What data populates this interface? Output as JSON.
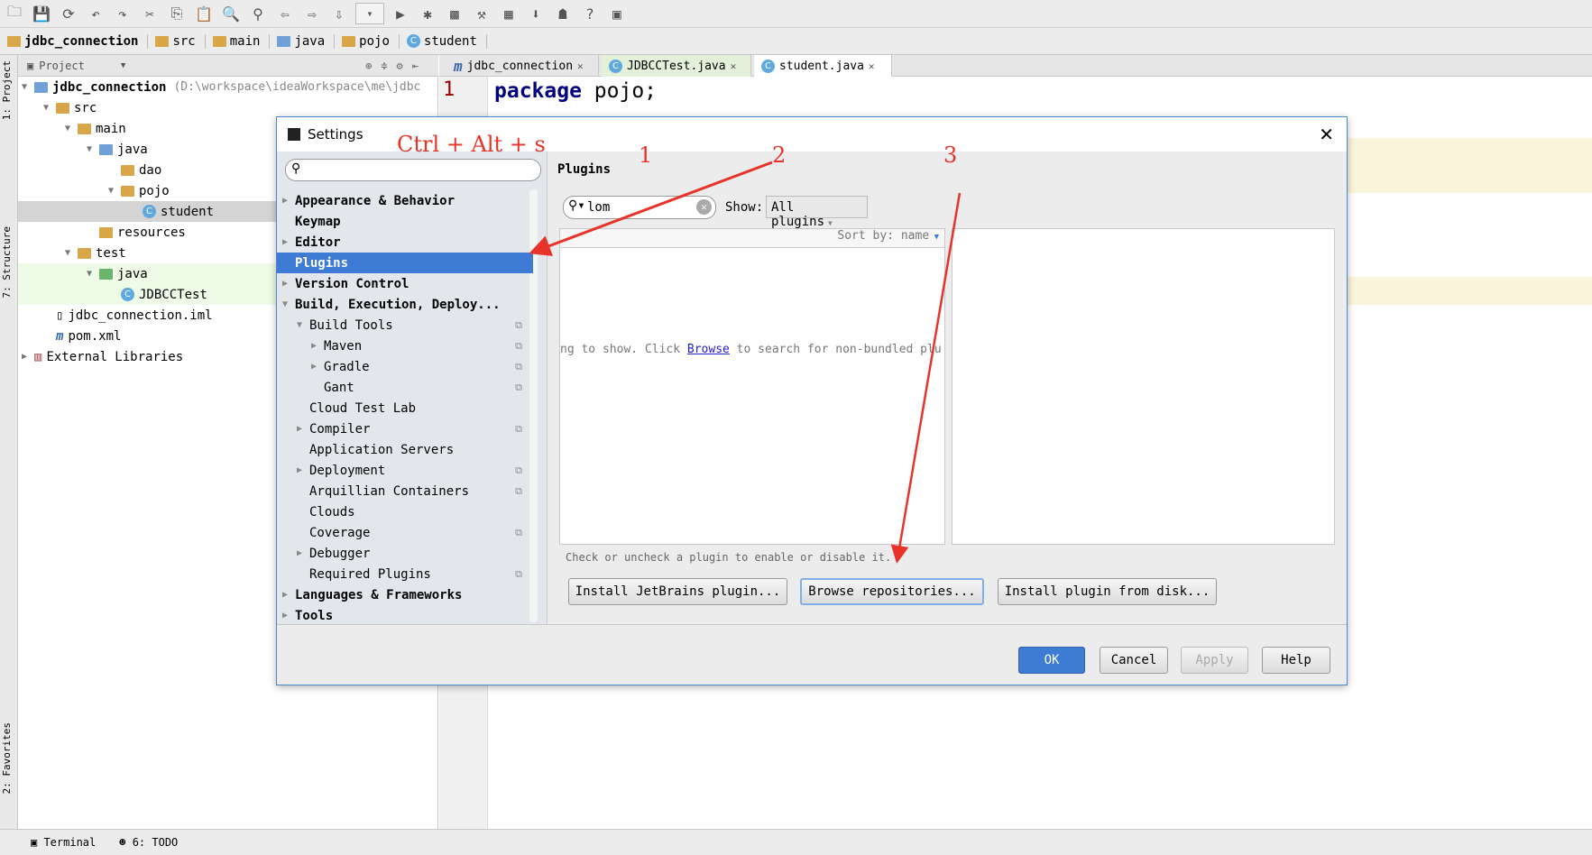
{
  "toolbar": {
    "icons": [
      "open-icon",
      "save-icon",
      "sync-icon",
      "undo-icon",
      "redo-icon",
      "cut-icon",
      "copy-icon",
      "paste-icon",
      "find-icon",
      "replace-icon",
      "back-icon",
      "forward-icon",
      "build-icon",
      "run-config-dropdown",
      "run-icon",
      "debug-icon",
      "coverage-icon",
      "project-structure-icon",
      "sdk-icon",
      "android-sdk-icon",
      "android-icon",
      "help-icon",
      "device-icon"
    ]
  },
  "breadcrumb": [
    "jdbc_connection",
    "src",
    "main",
    "java",
    "pojo",
    "student"
  ],
  "stripe": {
    "project": "1: Project",
    "structure": "7: Structure",
    "favorites": "2: Favorites"
  },
  "project_panel": {
    "title": "Project",
    "tree": [
      {
        "label": "jdbc_connection",
        "path": "(D:\\workspace\\ideaWorkspace\\me\\jdbc",
        "depth": 0,
        "icon": "module",
        "open": true,
        "bold": true
      },
      {
        "label": "src",
        "depth": 1,
        "icon": "folder",
        "open": true
      },
      {
        "label": "main",
        "depth": 2,
        "icon": "folder",
        "open": true
      },
      {
        "label": "java",
        "depth": 3,
        "icon": "source-folder",
        "open": true
      },
      {
        "label": "dao",
        "depth": 4,
        "icon": "package"
      },
      {
        "label": "pojo",
        "depth": 4,
        "icon": "package",
        "open": true
      },
      {
        "label": "student",
        "depth": 5,
        "icon": "class",
        "selected": true
      },
      {
        "label": "resources",
        "depth": 3,
        "icon": "resources-folder"
      },
      {
        "label": "test",
        "depth": 2,
        "icon": "folder",
        "open": true
      },
      {
        "label": "java",
        "depth": 3,
        "icon": "test-folder",
        "open": true,
        "green": true
      },
      {
        "label": "JDBCCTest",
        "depth": 4,
        "icon": "test-class",
        "green": true
      },
      {
        "label": "jdbc_connection.iml",
        "depth": 1,
        "icon": "file"
      },
      {
        "label": "pom.xml",
        "depth": 1,
        "icon": "maven"
      },
      {
        "label": "External Libraries",
        "depth": 0,
        "icon": "libraries",
        "closed": true
      }
    ]
  },
  "editor": {
    "tabs": [
      {
        "label": "jdbc_connection",
        "icon": "m"
      },
      {
        "label": "JDBCCTest.java",
        "icon": "C"
      },
      {
        "label": "student.java",
        "icon": "C",
        "active": true
      }
    ],
    "line_number": "1",
    "code_keyword": "package",
    "code_rest": " pojo;"
  },
  "status_bar": {
    "terminal": "Terminal",
    "todo": "6: TODO"
  },
  "dialog": {
    "title": "Settings",
    "nav": [
      {
        "label": "Appearance & Behavior",
        "level": 0,
        "arrow": "right",
        "bold": true
      },
      {
        "label": "Keymap",
        "level": 0,
        "bold": true
      },
      {
        "label": "Editor",
        "level": 0,
        "arrow": "right",
        "bold": true
      },
      {
        "label": "Plugins",
        "level": 0,
        "bold": true,
        "selected": true
      },
      {
        "label": "Version Control",
        "level": 0,
        "arrow": "right",
        "bold": true
      },
      {
        "label": "Build, Execution, Deploy...",
        "level": 0,
        "arrow": "down",
        "bold": true
      },
      {
        "label": "Build Tools",
        "level": 1,
        "arrow": "down",
        "copy": true
      },
      {
        "label": "Maven",
        "level": 2,
        "arrow": "right",
        "copy": true
      },
      {
        "label": "Gradle",
        "level": 2,
        "arrow": "right",
        "copy": true
      },
      {
        "label": "Gant",
        "level": 2,
        "copy": true
      },
      {
        "label": "Cloud Test Lab",
        "level": 1
      },
      {
        "label": "Compiler",
        "level": 1,
        "arrow": "right",
        "copy": true
      },
      {
        "label": "Application Servers",
        "level": 1
      },
      {
        "label": "Deployment",
        "level": 1,
        "arrow": "right",
        "copy": true
      },
      {
        "label": "Arquillian Containers",
        "level": 1,
        "copy": true
      },
      {
        "label": "Clouds",
        "level": 1
      },
      {
        "label": "Coverage",
        "level": 1,
        "copy": true
      },
      {
        "label": "Debugger",
        "level": 1,
        "arrow": "right"
      },
      {
        "label": "Required Plugins",
        "level": 1,
        "copy": true
      },
      {
        "label": "Languages & Frameworks",
        "level": 0,
        "arrow": "right",
        "bold": true
      },
      {
        "label": "Tools",
        "level": 0,
        "arrow": "right",
        "bold": true
      }
    ],
    "section_title": "Plugins",
    "search_value": "lom",
    "show_label": "Show:",
    "show_value": "All plugins",
    "sort_label": "Sort by: name",
    "empty_pre": "ng to show. Click ",
    "empty_link": "Browse",
    "empty_post": " to search for non-bundled plu",
    "hint": "Check or uncheck a plugin to enable or disable it.",
    "install_jetbrains": "Install JetBrains plugin...",
    "browse_repos": "Browse repositories...",
    "install_disk": "Install plugin from disk...",
    "ok": "OK",
    "cancel": "Cancel",
    "apply": "Apply",
    "help": "Help"
  },
  "annotations": {
    "shortcut": "Ctrl + Alt + s",
    "step1": "1",
    "step2": "2",
    "step3": "3",
    "color": "#e8332a"
  }
}
